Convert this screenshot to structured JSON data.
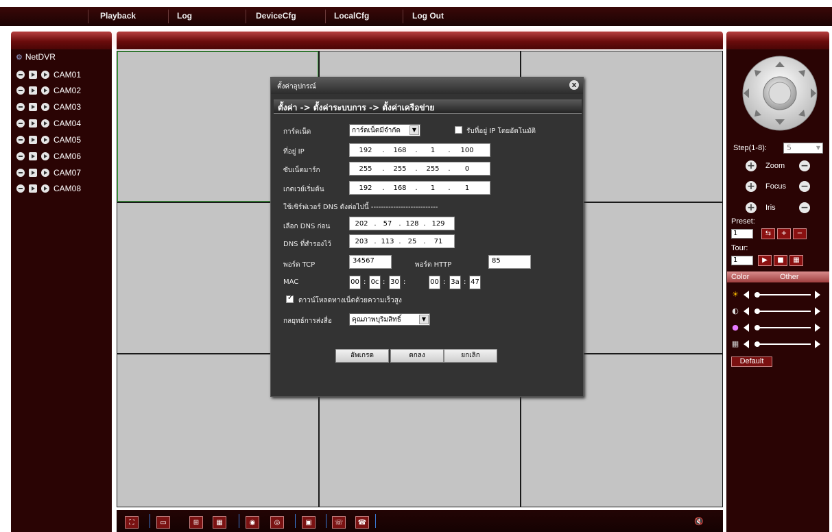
{
  "menu": [
    "Playback",
    "Log",
    "DeviceCfg",
    "LocalCfg",
    "Log Out"
  ],
  "tree": {
    "root": "NetDVR",
    "cameras": [
      "CAM01",
      "CAM02",
      "CAM03",
      "CAM04",
      "CAM05",
      "CAM06",
      "CAM07",
      "CAM08"
    ]
  },
  "dialog": {
    "title": "ตั้งค่าอุปกรณ์",
    "close": "x",
    "path": "ตั้งค่า -> ตั้งค่าระบบการ -> ตั้งค่าเครือข่าย",
    "netcard_label": "การ์ดเน็ต",
    "netcard_value": "การ์ดเน็ตมีจำกัด",
    "auto_ip_label": "รับที่อยู่ IP โดยอัตโนมัติ",
    "ip_label": "ที่อยู่ IP",
    "ip": [
      "192",
      "168",
      "1",
      "100"
    ],
    "subnet_label": "ซับเน็ตมาร์ก",
    "subnet": [
      "255",
      "255",
      "255",
      "0"
    ],
    "gateway_label": "เกตเวย์เริ่มต้น",
    "gateway": [
      "192",
      "168",
      "1",
      "1"
    ],
    "dns_header": "ใช้เซิร์ฟเวอร์ DNS ดังต่อไปนี้ ---------------------------",
    "dns1_label": "เลือก DNS ก่อน",
    "dns1": [
      "202",
      "57",
      "128",
      "129"
    ],
    "dns2_label": "DNS ที่สำรองไว้",
    "dns2": [
      "203",
      "113",
      "25",
      "71"
    ],
    "tcp_label": "พอร์ต TCP",
    "tcp_value": "34567",
    "http_label": "พอร์ต HTTP",
    "http_value": "85",
    "mac_label": "MAC",
    "mac": [
      "00",
      "0c",
      "30",
      "00",
      "3a",
      "47"
    ],
    "highspeed_label": "ดาวน์โหลดทางเน็ตด้วยความเร็วสูง",
    "strategy_label": "กลยุทธ์การส่งสื่อ",
    "strategy_value": "คุณภาพบุริมสิทธิ์",
    "btn_update": "อัพเกรด",
    "btn_ok": "ตกลง",
    "btn_cancel": "ยกเลิก"
  },
  "ptz": {
    "step_label": "Step(1-8):",
    "step_value": "5",
    "zoom": "Zoom",
    "focus": "Focus",
    "iris": "Iris",
    "preset_label": "Preset:",
    "preset_value": "1",
    "tour_label": "Tour:",
    "tour_value": "1"
  },
  "tabs": {
    "color": "Color",
    "other": "Other"
  },
  "default_label": "Default",
  "colors": {
    "topbar": "#1b0303",
    "panel": "#2a0404",
    "grid_line": "#1a1a1a",
    "cell": "#c4c4c4",
    "dialog": "#333333",
    "accent": "#7a1212"
  },
  "icons": {
    "ptz": "ptz-direction-icon",
    "brightness": "sun-icon",
    "contrast": "contrast-icon",
    "saturation": "color-wheel-icon",
    "hue": "grid-icon",
    "volume": "speaker-mute-icon"
  }
}
